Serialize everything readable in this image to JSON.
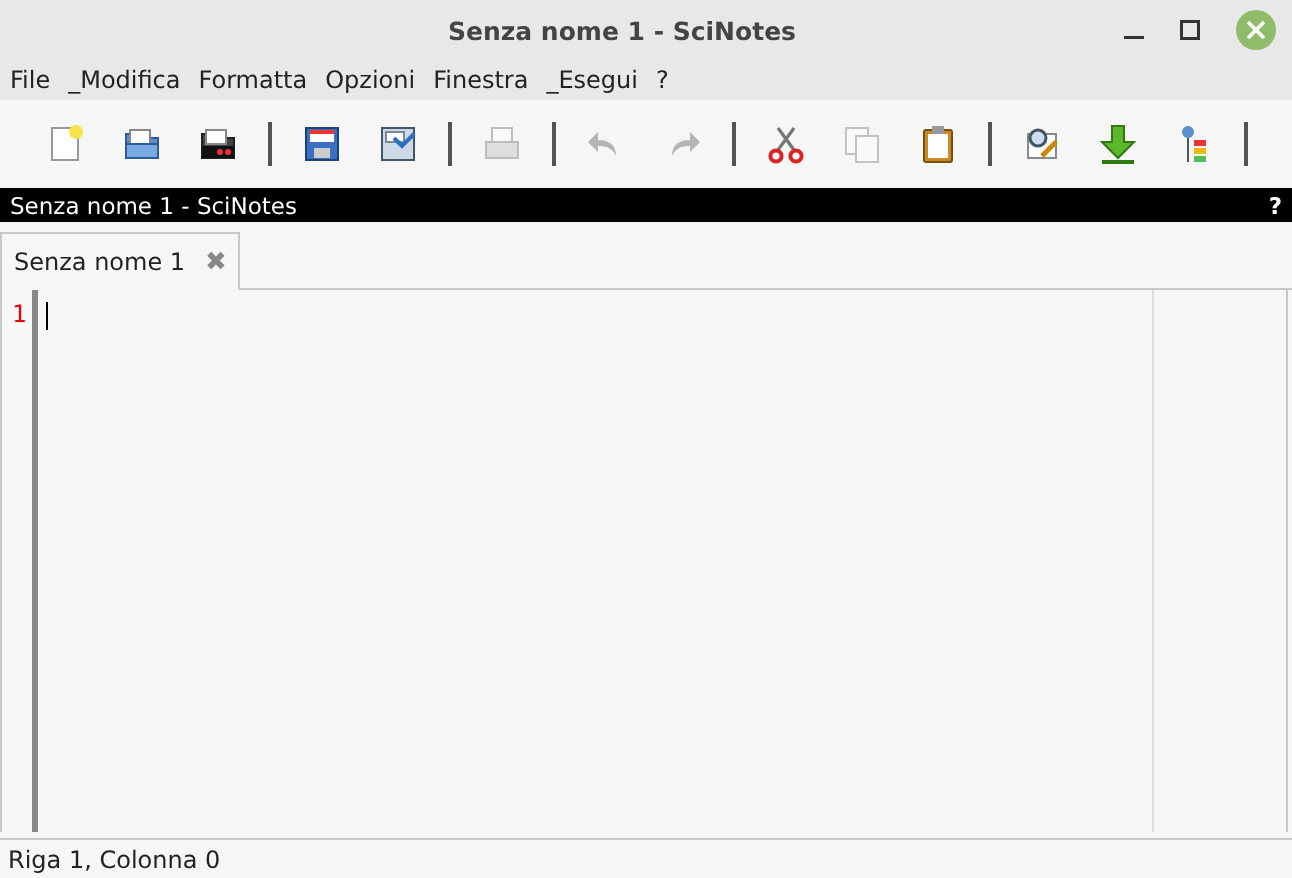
{
  "window": {
    "title": "Senza nome 1 - SciNotes"
  },
  "menu": [
    "File",
    "_Modifica",
    "Formatta",
    "Opzioni",
    "Finestra",
    "_Esegui",
    "?"
  ],
  "toolbar": [
    {
      "kind": "new",
      "disabled": false
    },
    {
      "kind": "open",
      "disabled": false
    },
    {
      "kind": "recent",
      "disabled": false
    },
    {
      "kind": "separator"
    },
    {
      "kind": "save",
      "disabled": false
    },
    {
      "kind": "saveas",
      "disabled": false
    },
    {
      "kind": "separator"
    },
    {
      "kind": "print",
      "disabled": true
    },
    {
      "kind": "separator"
    },
    {
      "kind": "undo",
      "disabled": true
    },
    {
      "kind": "redo",
      "disabled": true
    },
    {
      "kind": "separator"
    },
    {
      "kind": "cut",
      "disabled": false
    },
    {
      "kind": "copy",
      "disabled": true
    },
    {
      "kind": "paste",
      "disabled": false
    },
    {
      "kind": "separator"
    },
    {
      "kind": "find",
      "disabled": false
    },
    {
      "kind": "execute",
      "disabled": false
    },
    {
      "kind": "tree",
      "disabled": false
    },
    {
      "kind": "separator"
    }
  ],
  "dock": {
    "title": "Senza nome 1 - SciNotes",
    "help": "?"
  },
  "tabs": [
    {
      "label": "Senza nome 1",
      "selected": true,
      "close": "✖"
    }
  ],
  "editor": {
    "line_numbers": [
      "1"
    ]
  },
  "status_bar": "Riga 1, Colonna 0"
}
